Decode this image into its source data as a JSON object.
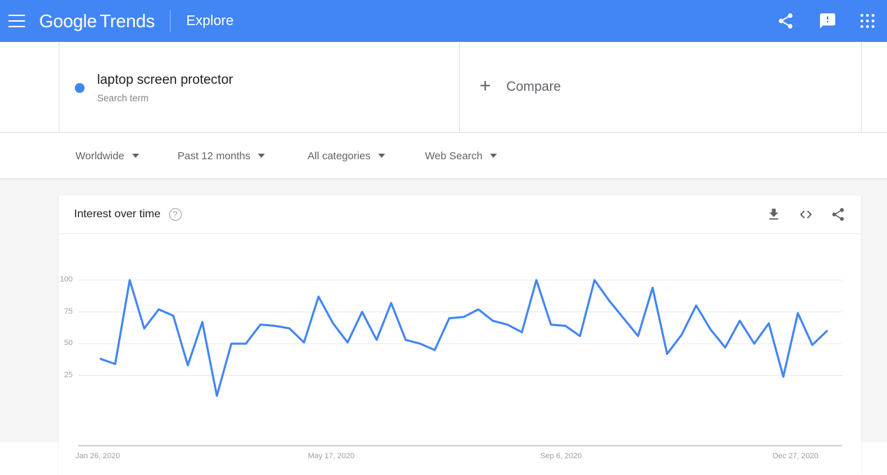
{
  "header": {
    "menu_icon": "hamburger-menu-icon",
    "brand_google": "Google",
    "brand_trends": "Trends",
    "explore_label": "Explore",
    "share_icon": "share-icon",
    "feedback_icon": "feedback-icon",
    "apps_icon": "apps-grid-icon",
    "background_color": "#4285f4"
  },
  "terms": {
    "search_term": {
      "title": "laptop screen protector",
      "subtitle": "Search term",
      "dot_color": "#4285f4"
    },
    "compare": {
      "plus": "+",
      "label": "Compare"
    }
  },
  "filters": [
    {
      "label": "Worldwide",
      "name": "filter-location"
    },
    {
      "label": "Past 12 months",
      "name": "filter-time-range"
    },
    {
      "label": "All categories",
      "name": "filter-category"
    },
    {
      "label": "Web Search",
      "name": "filter-search-type"
    }
  ],
  "card": {
    "title": "Interest over time",
    "help_icon": "?",
    "download_icon": "download-icon",
    "embed_icon": "embed-code-icon",
    "share_icon": "share-icon"
  },
  "chart_data": {
    "type": "line",
    "title": "Interest over time",
    "xlabel": "",
    "ylabel": "",
    "ylim": [
      0,
      100
    ],
    "yticks": [
      100,
      75,
      50,
      25
    ],
    "grid": true,
    "legend": false,
    "line_color": "#4285f4",
    "xticks": [
      "Jan 26, 2020",
      "May 17, 2020",
      "Sep 6, 2020",
      "Dec 27, 2020"
    ],
    "xtick_indices": [
      0,
      16,
      32,
      48
    ],
    "x": [
      "Jan 26, 2020",
      "Feb 2, 2020",
      "Feb 9, 2020",
      "Feb 16, 2020",
      "Feb 23, 2020",
      "Mar 1, 2020",
      "Mar 8, 2020",
      "Mar 15, 2020",
      "Mar 22, 2020",
      "Mar 29, 2020",
      "Apr 5, 2020",
      "Apr 12, 2020",
      "Apr 19, 2020",
      "Apr 26, 2020",
      "May 3, 2020",
      "May 10, 2020",
      "May 17, 2020",
      "May 24, 2020",
      "May 31, 2020",
      "Jun 7, 2020",
      "Jun 14, 2020",
      "Jun 21, 2020",
      "Jun 28, 2020",
      "Jul 5, 2020",
      "Jul 12, 2020",
      "Jul 19, 2020",
      "Jul 26, 2020",
      "Aug 2, 2020",
      "Aug 9, 2020",
      "Aug 16, 2020",
      "Aug 23, 2020",
      "Aug 30, 2020",
      "Sep 6, 2020",
      "Sep 13, 2020",
      "Sep 20, 2020",
      "Sep 27, 2020",
      "Oct 4, 2020",
      "Oct 11, 2020",
      "Oct 18, 2020",
      "Oct 25, 2020",
      "Nov 1, 2020",
      "Nov 8, 2020",
      "Nov 15, 2020",
      "Nov 22, 2020",
      "Nov 29, 2020",
      "Dec 6, 2020",
      "Dec 13, 2020",
      "Dec 20, 2020",
      "Dec 27, 2020",
      "Jan 3, 2021",
      "Jan 10, 2021"
    ],
    "values": [
      38,
      34,
      100,
      62,
      77,
      72,
      33,
      67,
      9,
      50,
      50,
      65,
      64,
      62,
      51,
      87,
      66,
      51,
      75,
      53,
      82,
      53,
      50,
      45,
      70,
      71,
      77,
      68,
      65,
      59,
      100,
      65,
      64,
      56,
      100,
      84,
      70,
      56,
      94,
      42,
      57,
      80,
      61,
      47,
      68,
      50,
      66,
      24,
      74,
      49,
      60
    ]
  }
}
